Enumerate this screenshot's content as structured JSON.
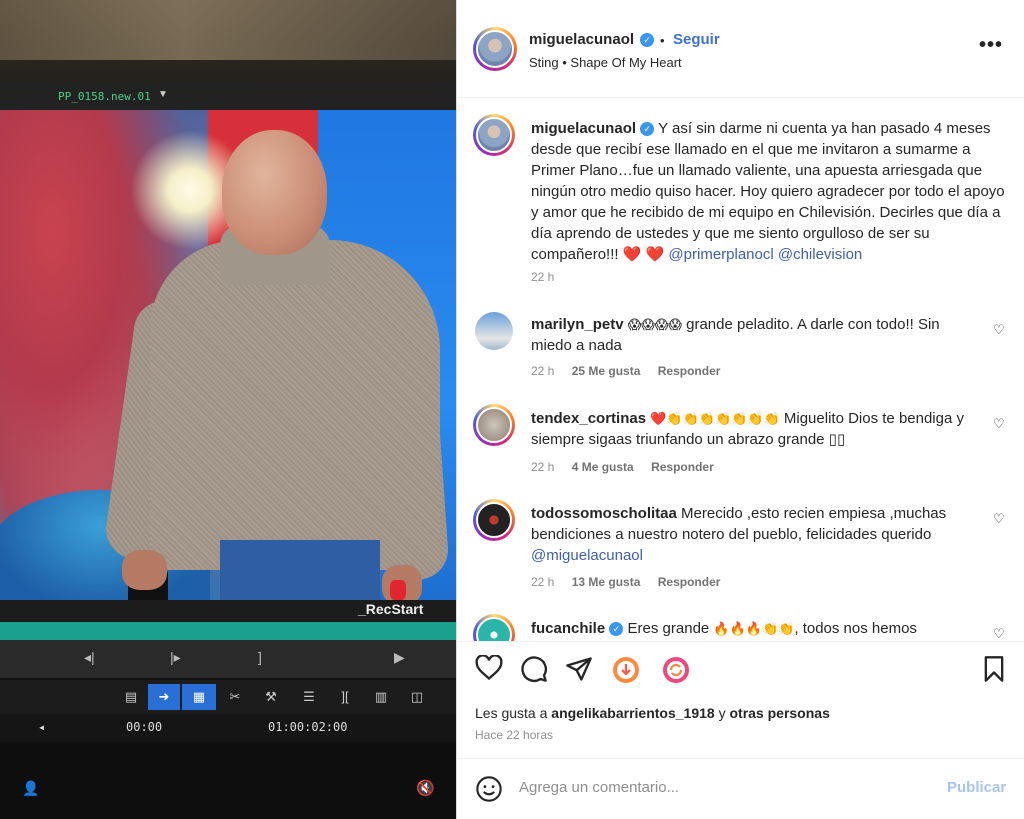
{
  "editor": {
    "clip_name": "PP_0158.new.01",
    "rec_label": "_RecStart",
    "timecode_start": "00:00",
    "timecode_mark": "01:00:02:00"
  },
  "post": {
    "username": "miguelacunaol",
    "follow_label": "Seguir",
    "song": "Sting • Shape Of My Heart",
    "caption": "Y así sin darme ni cuenta ya han pasado 4 meses desde que recibí ese llamado en el que me invitaron a sumarme a Primer Plano…fue un llamado valiente, una apuesta arriesgada que ningún otro medio quiso hacer. Hoy quiero agradecer por todo el apoyo y amor que he recibido de mi equipo en Chilevisión. Decirles que día a día aprendo de ustedes y que me siento orgulloso de ser su compañero!!!",
    "caption_emojis": "❤️ ❤️",
    "caption_mentions": "@primerplanocl @chilevision",
    "caption_time": "22 h"
  },
  "comments": [
    {
      "username": "marilyn_petv",
      "emojis": "😱😱😱😱",
      "text": "grande peladito. A darle con todo!! Sin miedo a nada",
      "time": "22 h",
      "likes": "25 Me gusta",
      "reply": "Responder"
    },
    {
      "username": "tendex_cortinas",
      "emojis": "❤️👏👏👏👏👏👏👏",
      "text": "Miguelito Dios te bendiga y siempre sigaas triunfando un abrazo grande ▯▯",
      "time": "22 h",
      "likes": "4 Me gusta",
      "reply": "Responder"
    },
    {
      "username": "todossomoscholitaa",
      "emojis": "",
      "text": "Merecido ,esto recien empiesa ,muchas bendiciones a nuestro notero del pueblo, felicidades querido",
      "mention": "@miguelacunaol",
      "time": "22 h",
      "likes": "13 Me gusta",
      "reply": "Responder"
    },
    {
      "username": "fucanchile",
      "emojis": "",
      "text_before": "Eres grande",
      "emojis_inline": "🔥🔥🔥👏👏",
      "text": ", todos nos hemos"
    }
  ],
  "footer": {
    "likes_prefix": "Les gusta a ",
    "likes_user": "angelikabarrientos_1918",
    "likes_middle": " y ",
    "likes_suffix": "otras personas",
    "posted": "Hace 22 horas",
    "comment_placeholder": "Agrega un comentario...",
    "post_label": "Publicar"
  }
}
